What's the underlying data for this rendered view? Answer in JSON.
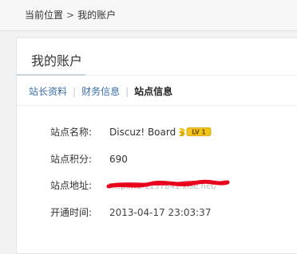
{
  "breadcrumb": {
    "current_position": "当前位置",
    "separator": ">",
    "my_account": "我的账户"
  },
  "panel": {
    "title": "我的账户"
  },
  "tabs": [
    {
      "label": "站长资料",
      "active": false
    },
    {
      "label": "财务信息",
      "active": false
    },
    {
      "label": "站点信息",
      "active": true
    }
  ],
  "tab_separator": "|",
  "site_info": {
    "name_label": "站点名称:",
    "name_value": "Discuz! Board",
    "level_badge": "LV 1",
    "score_label": "站点积分:",
    "score_value": "690",
    "url_label": "站点地址:",
    "url_value": "http://f1.1157841.xise.net/",
    "opened_label": "开通时间:",
    "opened_value": "2013-04-17 23:03:37"
  },
  "colors": {
    "link": "#3a6ea5",
    "badge_gold": "#f0c419",
    "redaction": "#e8001c"
  }
}
